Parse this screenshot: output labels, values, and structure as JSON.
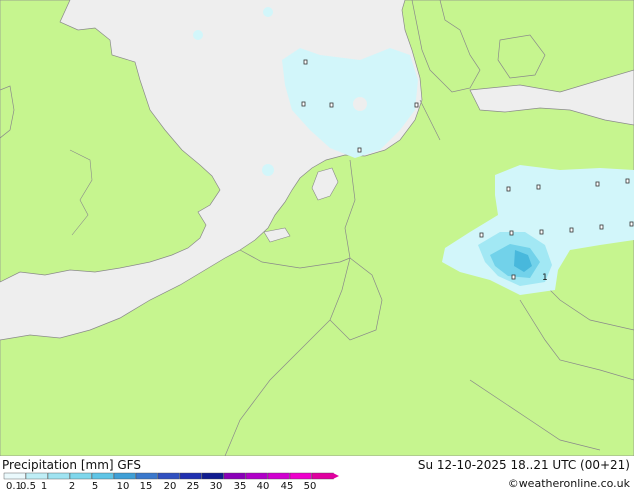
{
  "map": {
    "colors": {
      "sea": "#eeeeee",
      "land": "#c6f58f",
      "border": "#8a8a8a",
      "precip_light": "#d2f6fa",
      "precip_mid": "#a2e8f4",
      "precip_heavy": "#72d2ea",
      "precip_core": "#48b8dc"
    },
    "point_labels": [
      "1"
    ]
  },
  "footer": {
    "left_title": "Precipitation [mm]  GFS",
    "datetime": "Su 12-10-2025 18..21 UTC (00+21)",
    "credit": "©weatheronline.co.uk"
  },
  "legend": {
    "ticks": [
      "0.1",
      "0.5",
      "1",
      "2",
      "5",
      "10",
      "15",
      "20",
      "25",
      "30",
      "35",
      "40",
      "45",
      "50"
    ],
    "colors": [
      "#eaf9fc",
      "#bfeef6",
      "#9fe3f1",
      "#7fd7ec",
      "#5fc5e6",
      "#3f9fd6",
      "#3a78cc",
      "#3050c0",
      "#2030b0",
      "#101c90",
      "#8a00b8",
      "#b000c8",
      "#d000d0",
      "#ee00cc",
      "#e000a0"
    ]
  }
}
